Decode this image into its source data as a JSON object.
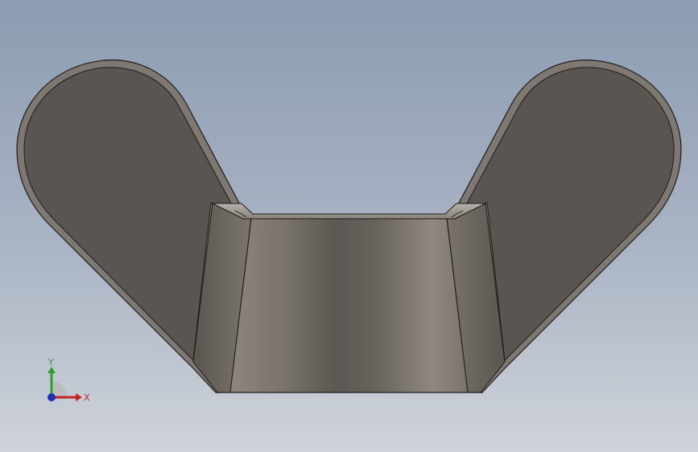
{
  "viewport": {
    "background_top": "#8e9db3",
    "background_bottom": "#cdd1d9"
  },
  "model": {
    "part": "wing-nut",
    "face_dark": "#5b5550",
    "face_light": "#8e8680",
    "edge_color": "#1e1c1a"
  },
  "triad": {
    "x_label": "X",
    "y_label": "Y",
    "x_color": "#c0262a",
    "y_color": "#2ea02e",
    "z_color": "#1f2fb0"
  }
}
